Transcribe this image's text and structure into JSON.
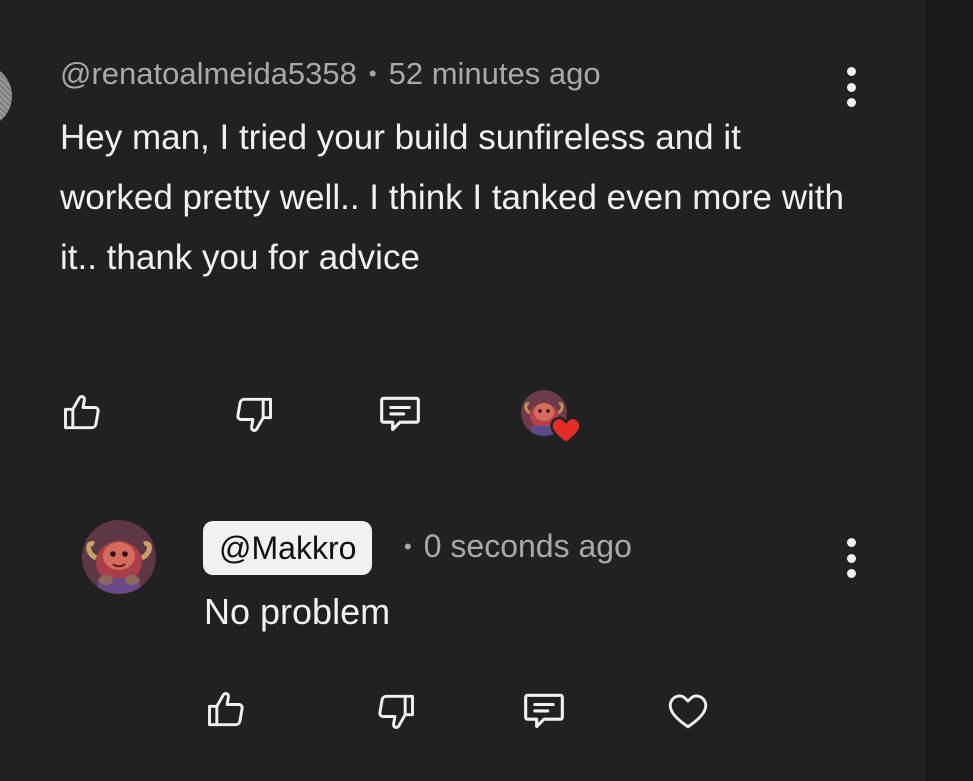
{
  "comment": {
    "author": "@renatoalmeida5358",
    "separator": "•",
    "timestamp": "52 minutes ago",
    "text": "Hey man, I tried your build sunfireless and it worked pretty well.. I think I tanked even more with it.. thank you for advice",
    "actions": {
      "like_icon": "thumbs-up-icon",
      "dislike_icon": "thumbs-down-icon",
      "reply_icon": "reply-comment-icon",
      "creator_heart_icon": "creator-heart-avatar",
      "more_icon": "more-vertical-icon"
    }
  },
  "reply": {
    "author": "@Makkro",
    "separator": "•",
    "timestamp": "0 seconds ago",
    "text": "No problem",
    "actions": {
      "like_icon": "thumbs-up-icon",
      "dislike_icon": "thumbs-down-icon",
      "reply_icon": "reply-comment-icon",
      "heart_icon": "heart-outline-icon",
      "more_icon": "more-vertical-icon"
    }
  },
  "colors": {
    "background": "#212121",
    "text_primary": "#f1f1f1",
    "text_secondary": "#a9a9a9",
    "heart_red": "#e52d27",
    "chip_background": "#f1f1f1"
  }
}
